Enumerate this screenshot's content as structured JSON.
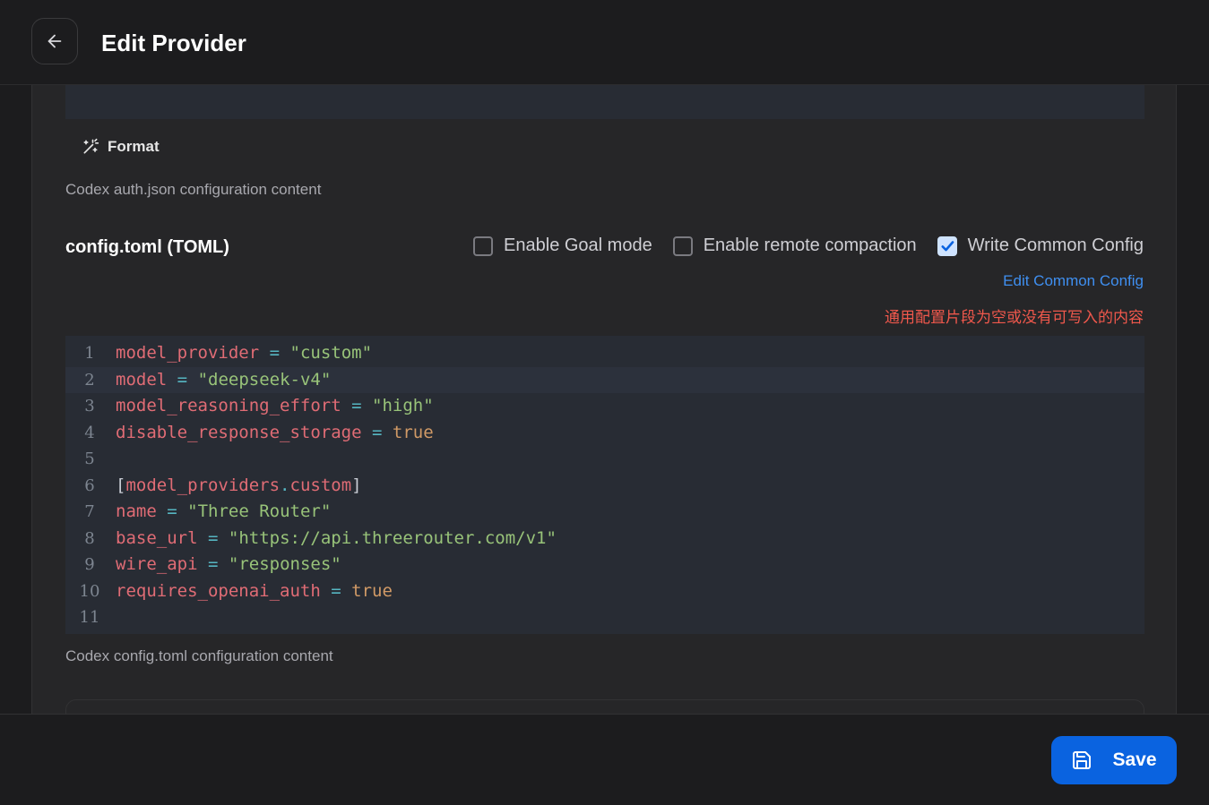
{
  "header": {
    "title": "Edit Provider",
    "back_icon": "arrow-left-icon"
  },
  "format": {
    "label": "Format",
    "icon": "magic-wand-icon"
  },
  "auth_hint": "Codex auth.json configuration content",
  "config_section": {
    "title": "config.toml (TOML)",
    "options": [
      {
        "label": "Enable Goal mode",
        "checked": false
      },
      {
        "label": "Enable remote compaction",
        "checked": false
      },
      {
        "label": "Write Common Config",
        "checked": true
      }
    ],
    "edit_common_link": "Edit Common Config",
    "warning": "通用配置片段为空或没有可写入的内容",
    "hint": "Codex config.toml configuration content"
  },
  "editor": {
    "active_line": 2,
    "lines": [
      {
        "n": "1",
        "tokens": [
          [
            "k",
            "model_provider"
          ],
          [
            "p",
            " "
          ],
          [
            "op",
            "="
          ],
          [
            "p",
            " "
          ],
          [
            "s",
            "\"custom\""
          ]
        ]
      },
      {
        "n": "2",
        "tokens": [
          [
            "k",
            "model"
          ],
          [
            "p",
            " "
          ],
          [
            "op",
            "="
          ],
          [
            "p",
            " "
          ],
          [
            "s",
            "\"deepseek-v4\""
          ]
        ]
      },
      {
        "n": "3",
        "tokens": [
          [
            "k",
            "model_reasoning_effort"
          ],
          [
            "p",
            " "
          ],
          [
            "op",
            "="
          ],
          [
            "p",
            " "
          ],
          [
            "s",
            "\"high\""
          ]
        ]
      },
      {
        "n": "4",
        "tokens": [
          [
            "k",
            "disable_response_storage"
          ],
          [
            "p",
            " "
          ],
          [
            "op",
            "="
          ],
          [
            "p",
            " "
          ],
          [
            "b",
            "true"
          ]
        ]
      },
      {
        "n": "5",
        "tokens": []
      },
      {
        "n": "6",
        "tokens": [
          [
            "p",
            "["
          ],
          [
            "k",
            "model_providers"
          ],
          [
            "op",
            "."
          ],
          [
            "k",
            "custom"
          ],
          [
            "p",
            "]"
          ]
        ]
      },
      {
        "n": "7",
        "tokens": [
          [
            "k",
            "name"
          ],
          [
            "p",
            " "
          ],
          [
            "op",
            "="
          ],
          [
            "p",
            " "
          ],
          [
            "s",
            "\"Three Router\""
          ]
        ]
      },
      {
        "n": "8",
        "tokens": [
          [
            "k",
            "base_url"
          ],
          [
            "p",
            " "
          ],
          [
            "op",
            "="
          ],
          [
            "p",
            " "
          ],
          [
            "s",
            "\"https://api.threerouter.com/v1\""
          ]
        ]
      },
      {
        "n": "9",
        "tokens": [
          [
            "k",
            "wire_api"
          ],
          [
            "p",
            " "
          ],
          [
            "op",
            "="
          ],
          [
            "p",
            " "
          ],
          [
            "s",
            "\"responses\""
          ]
        ]
      },
      {
        "n": "10",
        "tokens": [
          [
            "k",
            "requires_openai_auth"
          ],
          [
            "p",
            " "
          ],
          [
            "op",
            "="
          ],
          [
            "p",
            " "
          ],
          [
            "b",
            "true"
          ]
        ]
      },
      {
        "n": "11",
        "tokens": []
      }
    ]
  },
  "footer": {
    "save_label": "Save",
    "save_icon": "floppy-disk-icon"
  },
  "colors": {
    "accent": "#0a63e0",
    "link": "#3f8ff0",
    "warning": "#f0584c"
  }
}
